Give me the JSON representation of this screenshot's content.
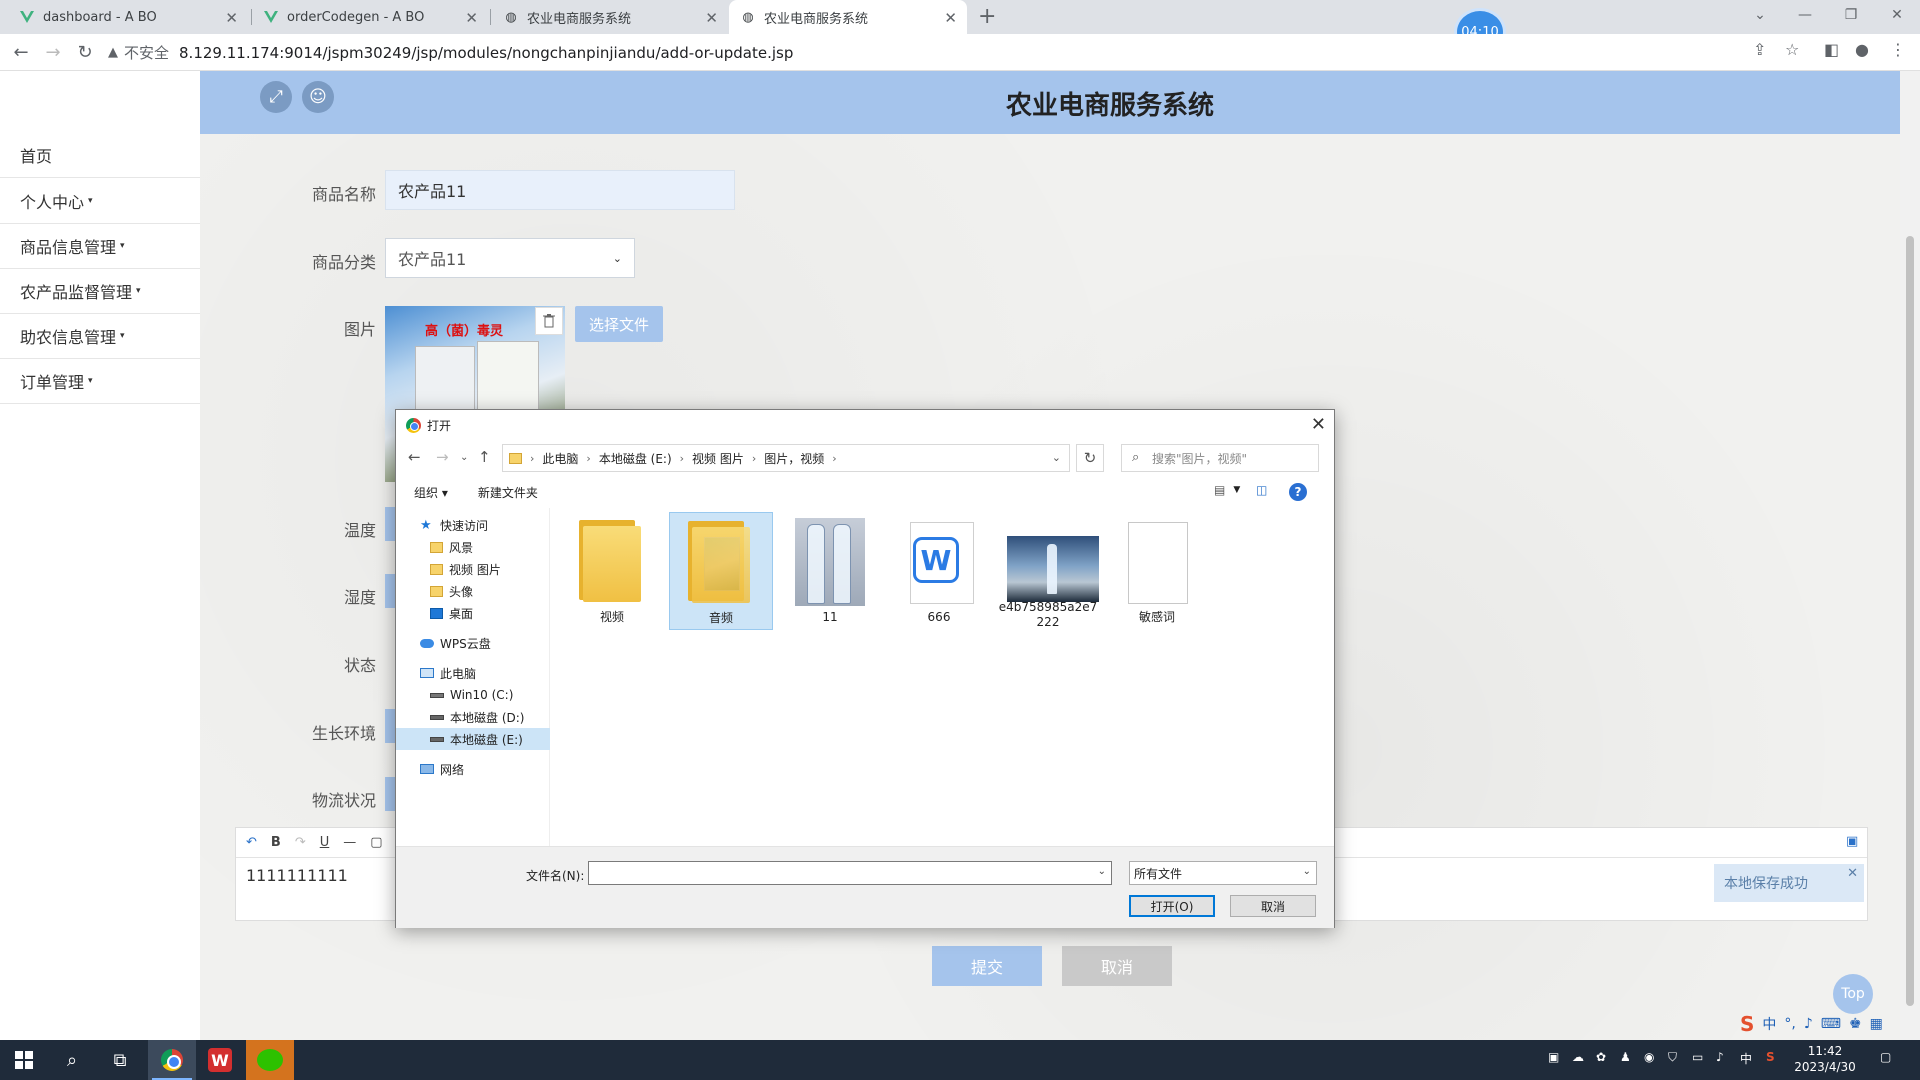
{
  "browser": {
    "tabs": [
      {
        "title": "dashboard - A BO"
      },
      {
        "title": "orderCodegen - A BO"
      },
      {
        "title": "农业电商服务系统"
      },
      {
        "title": "农业电商服务系统"
      }
    ],
    "timer": "04:10",
    "insecure_label": "不安全",
    "url": "8.129.11.174:9014/jspm30249/jsp/modules/nongchanpinjiandu/add-or-update.jsp"
  },
  "header": {
    "title": "农业电商服务系统"
  },
  "sidebar": {
    "items": [
      {
        "label": "首页",
        "caret": ""
      },
      {
        "label": "个人中心",
        "caret": "▾"
      },
      {
        "label": "商品信息管理",
        "caret": "▾"
      },
      {
        "label": "农产品监督管理",
        "caret": "▾"
      },
      {
        "label": "助农信息管理",
        "caret": "▾"
      },
      {
        "label": "订单管理",
        "caret": "▾"
      }
    ]
  },
  "form": {
    "name_label": "商品名称",
    "name_value": "农产品11",
    "category_label": "商品分类",
    "category_value": "农产品11",
    "image_label": "图片",
    "image_text": "高（菌）毒灵",
    "choose_file": "选择文件",
    "temp_label": "温度",
    "humidity_label": "湿度",
    "status_label": "状态",
    "env_label": "生长环境",
    "logistics_label": "物流状况",
    "editor_content": "1111111111",
    "submit": "提交",
    "cancel": "取消"
  },
  "toast": {
    "text": "本地保存成功"
  },
  "top_button": "Top",
  "ime": {
    "lang": "中"
  },
  "dialog": {
    "title": "打开",
    "breadcrumb": [
      "此电脑",
      "本地磁盘 (E:)",
      "视频 图片",
      "图片，视频"
    ],
    "search_placeholder": "搜索\"图片，视频\"",
    "organize": "组织",
    "new_folder": "新建文件夹",
    "tree": [
      {
        "label": "快速访问",
        "icon": "star-icon"
      },
      {
        "label": "风景",
        "icon": "folder-icon"
      },
      {
        "label": "视频 图片",
        "icon": "folder-icon"
      },
      {
        "label": "头像",
        "icon": "folder-icon"
      },
      {
        "label": "桌面",
        "icon": "desktop-icon"
      },
      {
        "label": "WPS云盘",
        "icon": "cloud-icon"
      },
      {
        "label": "此电脑",
        "icon": "computer-icon"
      },
      {
        "label": "Win10 (C:)",
        "icon": "drive-icon"
      },
      {
        "label": "本地磁盘 (D:)",
        "icon": "drive-icon"
      },
      {
        "label": "本地磁盘 (E:)",
        "icon": "drive-icon"
      },
      {
        "label": "网络",
        "icon": "network-icon"
      }
    ],
    "files": [
      {
        "name": "视频",
        "kind": "folder"
      },
      {
        "name": "音频",
        "kind": "folder"
      },
      {
        "name": "11",
        "kind": "image"
      },
      {
        "name": "666",
        "kind": "wps-doc"
      },
      {
        "name": "e4b758985a2e7222",
        "kind": "image"
      },
      {
        "name": "敏感词",
        "kind": "text"
      }
    ],
    "filename_label": "文件名(N):",
    "filename_value": "",
    "filetype": "所有文件",
    "open_button": "打开(O)",
    "cancel_button": "取消"
  },
  "taskbar": {
    "time": "11:42",
    "date": "2023/4/30",
    "ime": "中"
  }
}
